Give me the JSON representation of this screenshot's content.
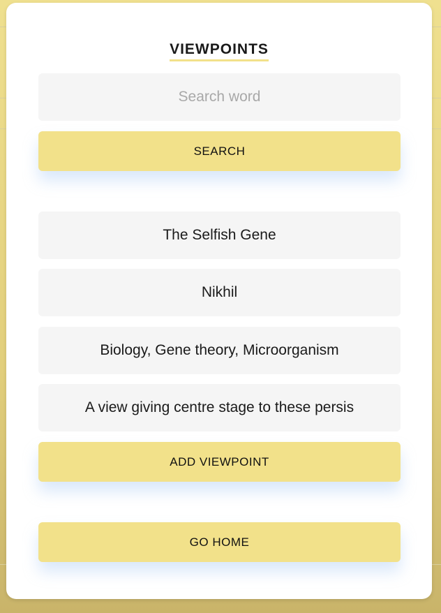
{
  "page": {
    "title": "VIEWPOINTS"
  },
  "search": {
    "placeholder": "Search word",
    "button_label": "SEARCH"
  },
  "form": {
    "book_title": "The Selfish Gene",
    "author": "Nikhil",
    "tags": "Biology, Gene theory, Microorganism",
    "viewpoint": "A view giving centre stage to these persis",
    "add_button_label": "ADD VIEWPOINT"
  },
  "nav": {
    "home_button_label": "GO HOME"
  },
  "colors": {
    "accent": "#f2e18a",
    "field_bg": "#f5f5f5",
    "backdrop": "#efe08f"
  }
}
